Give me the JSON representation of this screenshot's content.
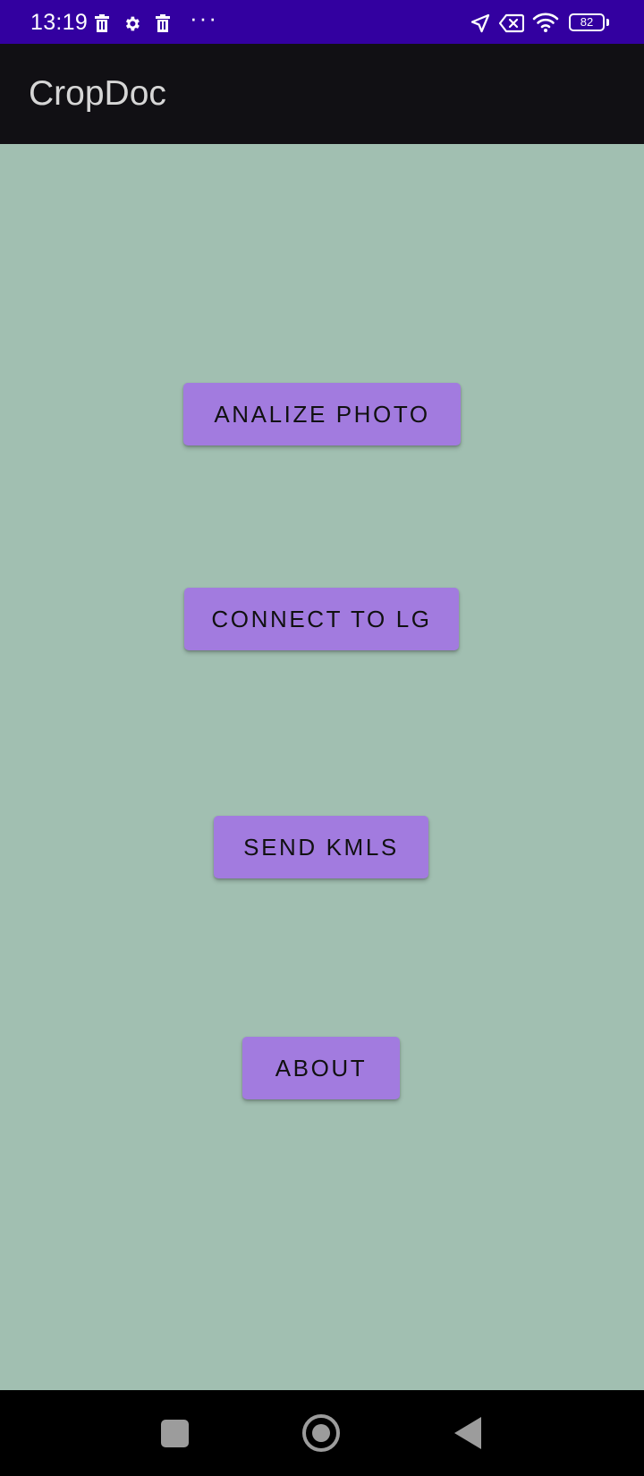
{
  "status_bar": {
    "time": "13:19",
    "battery_level": "82",
    "icons": [
      "trash-icon",
      "gear-icon",
      "trash-icon",
      "more-dots-icon",
      "navigation-arrow-icon",
      "no-sim-icon",
      "wifi-icon",
      "battery-icon"
    ],
    "more_dots": "···"
  },
  "app_bar": {
    "title": "CropDoc"
  },
  "main": {
    "buttons": [
      {
        "label": "ANALIZE PHOTO"
      },
      {
        "label": "CONNECT TO LG"
      },
      {
        "label": "SEND KMLS"
      },
      {
        "label": "ABOUT"
      }
    ]
  },
  "nav_bar": {
    "icons": [
      "recents-square-icon",
      "home-circle-icon",
      "back-triangle-icon"
    ]
  },
  "colors": {
    "status_bar": "#3300a0",
    "app_bar": "#111014",
    "background": "#a1bfb1",
    "button": "#a27bdf",
    "nav_bar": "#000000"
  }
}
